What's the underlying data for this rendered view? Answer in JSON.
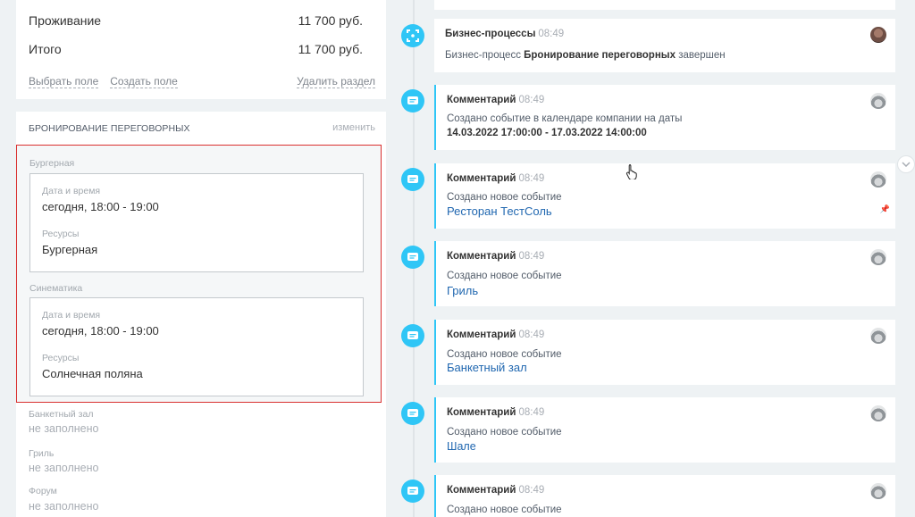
{
  "summary": {
    "rows": [
      {
        "label": "Проживание",
        "value": "11 700 руб."
      },
      {
        "label": "Итого",
        "value": "11 700 руб."
      }
    ],
    "links": {
      "choose_field": "Выбрать поле",
      "create_field": "Создать поле",
      "delete_section": "Удалить раздел"
    }
  },
  "booking_section": {
    "title": "БРОНИРОВАНИЕ ПЕРЕГОВОРНЫХ",
    "edit": "изменить",
    "groups": [
      {
        "name": "Бургерная",
        "date_label": "Дата и время",
        "date_value": "сегодня, 18:00 - 19:00",
        "res_label": "Ресурсы",
        "res_value": "Бургерная"
      },
      {
        "name": "Синематика",
        "date_label": "Дата и время",
        "date_value": "сегодня, 18:00 - 19:00",
        "res_label": "Ресурсы",
        "res_value": "Солнечная поляна"
      }
    ],
    "empty_fields": [
      {
        "label": "Банкетный зал",
        "value": "не заполнено"
      },
      {
        "label": "Гриль",
        "value": "не заполнено"
      },
      {
        "label": "Форум",
        "value": "не заполнено"
      }
    ]
  },
  "timeline": {
    "items": [
      {
        "kind": "process",
        "title": "Бизнес-процессы",
        "time": "08:49",
        "text_pre": "Бизнес-процесс ",
        "text_bold": "Бронирование переговорных",
        "text_post": " завершен"
      },
      {
        "kind": "comment",
        "title": "Комментарий",
        "time": "08:49",
        "text": "Создано событие в календаре компании на даты",
        "bold": "14.03.2022 17:00:00 - 17.03.2022 14:00:00"
      },
      {
        "kind": "comment",
        "title": "Комментарий",
        "time": "08:49",
        "text": "Создано новое событие",
        "link": "Ресторан ТестСоль"
      },
      {
        "kind": "comment",
        "title": "Комментарий",
        "time": "08:49",
        "text": "Создано новое событие",
        "link": "Гриль"
      },
      {
        "kind": "comment",
        "title": "Комментарий",
        "time": "08:49",
        "text": "Создано новое событие",
        "link": "Банкетный зал"
      },
      {
        "kind": "comment",
        "title": "Комментарий",
        "time": "08:49",
        "text": "Создано новое событие",
        "link": "Шале"
      },
      {
        "kind": "comment",
        "title": "Комментарий",
        "time": "08:49",
        "text": "Создано новое событие"
      }
    ]
  },
  "icons": {
    "process": "business-process-icon",
    "comment": "comment-icon",
    "scroll": "chevron-down-icon",
    "pin": "pin-icon"
  },
  "colors": {
    "accent": "#2fc6f6",
    "link": "#2067b0",
    "highlight_border": "#d9302f"
  }
}
